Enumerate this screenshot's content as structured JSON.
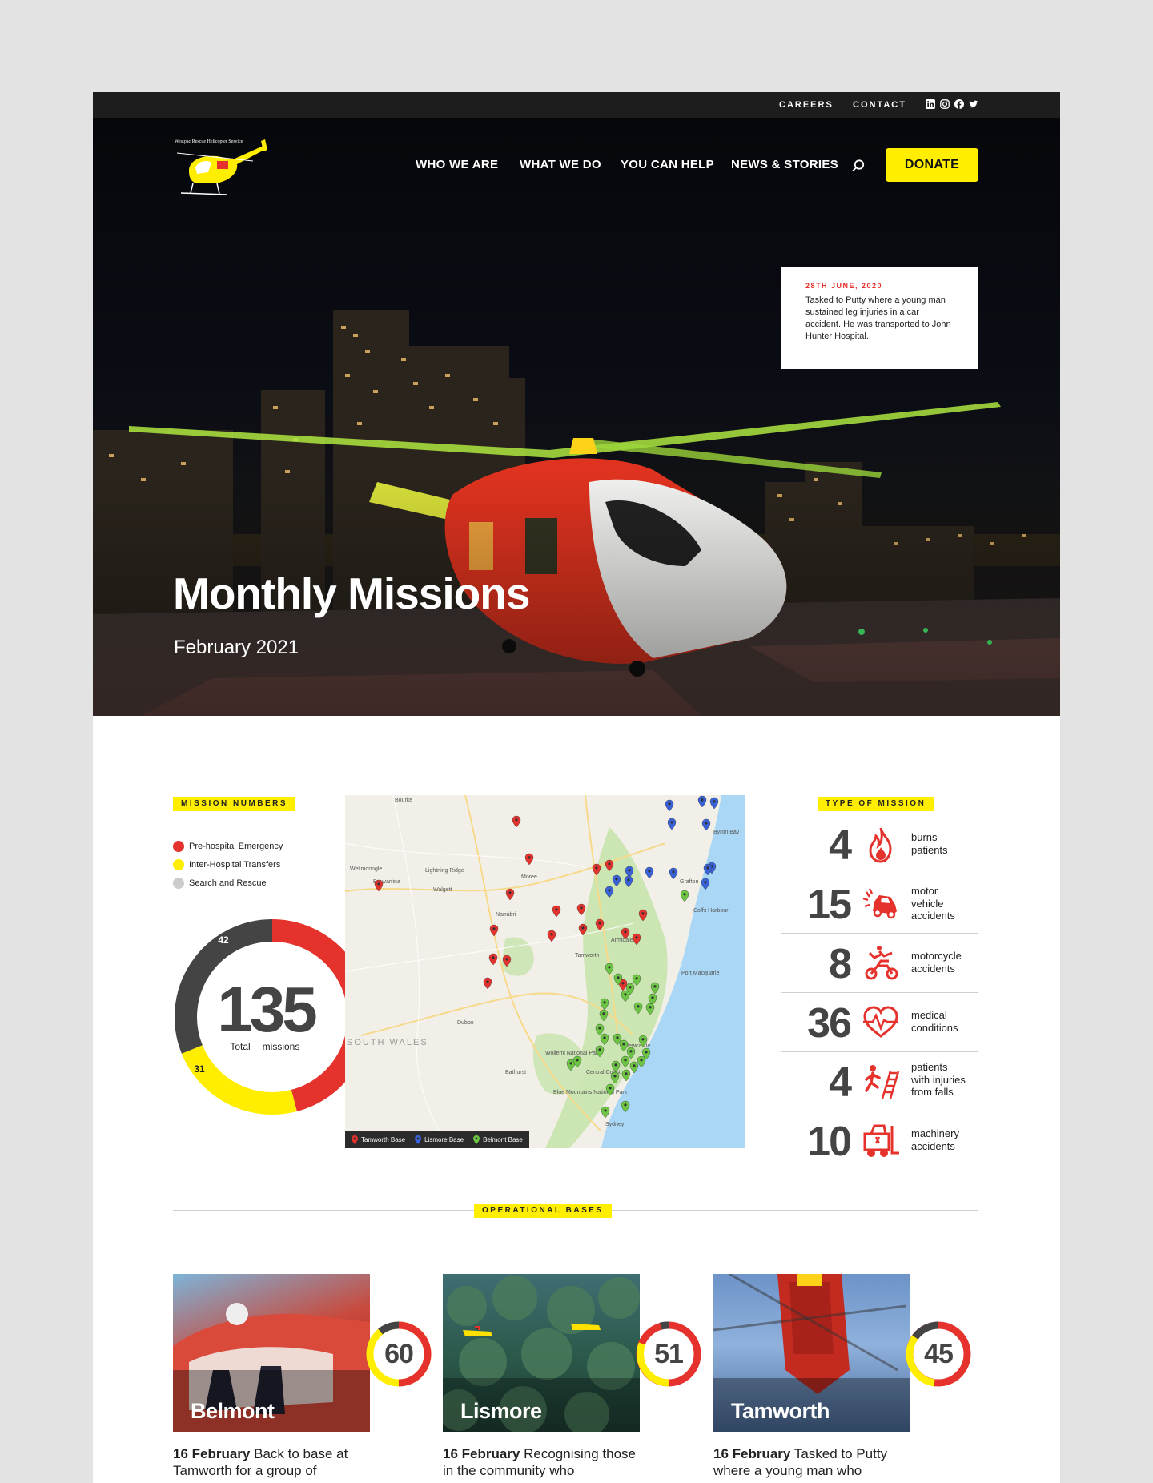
{
  "topbar": {
    "careers": "CAREERS",
    "contact": "CONTACT"
  },
  "logo": {
    "text": "Westpac Rescue Helicopter Service"
  },
  "nav": {
    "items": [
      "WHO WE ARE",
      "WHAT WE DO",
      "YOU CAN HELP",
      "NEWS & STORIES"
    ],
    "donate": "DONATE"
  },
  "tooltip": {
    "date": "28TH JUNE, 2020",
    "text": "Tasked to Putty where a young man sustained leg injuries in a car accident. He was transported to John Hunter Hospital."
  },
  "hero": {
    "title": "Monthly Missions",
    "subtitle": "February 2021"
  },
  "mission_numbers": {
    "tag": "MISSION NUMBERS",
    "legend": [
      {
        "label": "Pre-hospital Emergency",
        "color": "#e5322d"
      },
      {
        "label": "Inter-Hospital Transfers",
        "color": "#ffee00"
      },
      {
        "label": "Search and Rescue",
        "color": "#cccccc"
      }
    ],
    "total": "135",
    "total_label_a": "Total",
    "total_label_b": "missions",
    "segments": [
      {
        "label": "62",
        "value": 62,
        "color": "#e5322d"
      },
      {
        "label": "31",
        "value": 31,
        "color": "#ffee00"
      },
      {
        "label": "42",
        "value": 42,
        "color": "#444444"
      }
    ]
  },
  "map": {
    "legend": [
      "Tamworth Base",
      "Lismore Base",
      "Belmont Base"
    ],
    "legend_colors": [
      "#e5322d",
      "#3a62d8",
      "#6cc644"
    ],
    "place_labels": [
      "Bourke",
      "Brewarrina",
      "Wellmoringle",
      "Lightning Ridge",
      "Walgett",
      "Moree",
      "Narrabri",
      "Tamworth",
      "Armidale",
      "Grafton",
      "Coffs Harbour",
      "Byron Bay",
      "Port Macquarie",
      "Dubbo",
      "Newcastle",
      "Bathurst",
      "Wollemi National Park",
      "Blue Mountains National Park",
      "Central Coast",
      "Sydney",
      "SOUTH WALES"
    ]
  },
  "mission_types": {
    "tag": "TYPE OF MISSION",
    "items": [
      {
        "value": "4",
        "icon": "fire-icon",
        "lines": [
          "burns",
          "patients"
        ]
      },
      {
        "value": "15",
        "icon": "car-crash-icon",
        "lines": [
          "motor",
          "vehicle",
          "accidents"
        ]
      },
      {
        "value": "8",
        "icon": "motorcycle-crash-icon",
        "lines": [
          "motorcycle",
          "accidents"
        ]
      },
      {
        "value": "36",
        "icon": "heartbeat-icon",
        "lines": [
          "medical",
          "conditions"
        ]
      },
      {
        "value": "4",
        "icon": "ladder-fall-icon",
        "lines": [
          "patients",
          "with injuries",
          "from falls"
        ]
      },
      {
        "value": "10",
        "icon": "forklift-icon",
        "lines": [
          "machinery",
          "accidents"
        ]
      }
    ]
  },
  "operational": {
    "tag": "OPERATIONAL BASES",
    "bases": [
      {
        "name": "Belmont",
        "count": "60",
        "date": "16 February",
        "text": "Back to base at Tamworth for a group of"
      },
      {
        "name": "Lismore",
        "count": "51",
        "date": "16 February",
        "text": "Recognising those in the community who"
      },
      {
        "name": "Tamworth",
        "count": "45",
        "date": "16 February",
        "text": "Tasked to Putty where a young man who"
      }
    ]
  },
  "colors": {
    "accent_yellow": "#ffee00",
    "accent_red": "#e5322d",
    "dark": "#1d1d1d"
  }
}
